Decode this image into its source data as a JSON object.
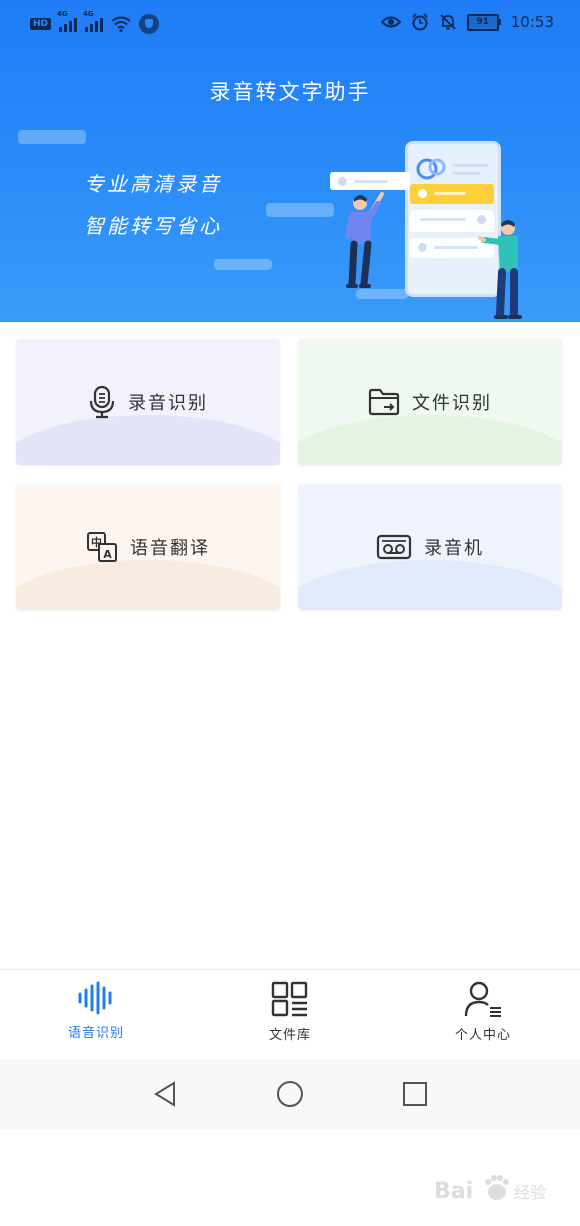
{
  "status_bar": {
    "hd_badge": "HD",
    "network_1": "4G",
    "network_2": "4G",
    "battery": "91",
    "time": "10:53"
  },
  "header": {
    "title": "录音转文字助手",
    "slogan_line1": "专业高清录音",
    "slogan_line2": "智能转写省心"
  },
  "features": [
    {
      "label": "录音识别",
      "icon": "microphone-icon"
    },
    {
      "label": "文件识别",
      "icon": "folder-icon"
    },
    {
      "label": "语音翻译",
      "icon": "translate-icon"
    },
    {
      "label": "录音机",
      "icon": "recorder-icon"
    }
  ],
  "bottom_nav": {
    "items": [
      {
        "label": "语音识别",
        "icon": "soundwave-icon",
        "active": true
      },
      {
        "label": "文件库",
        "icon": "grid-list-icon",
        "active": false
      },
      {
        "label": "个人中心",
        "icon": "user-list-icon",
        "active": false
      }
    ]
  },
  "colors": {
    "primary": "#1f7cf6",
    "header_gradient_end": "#3a9bf9"
  }
}
